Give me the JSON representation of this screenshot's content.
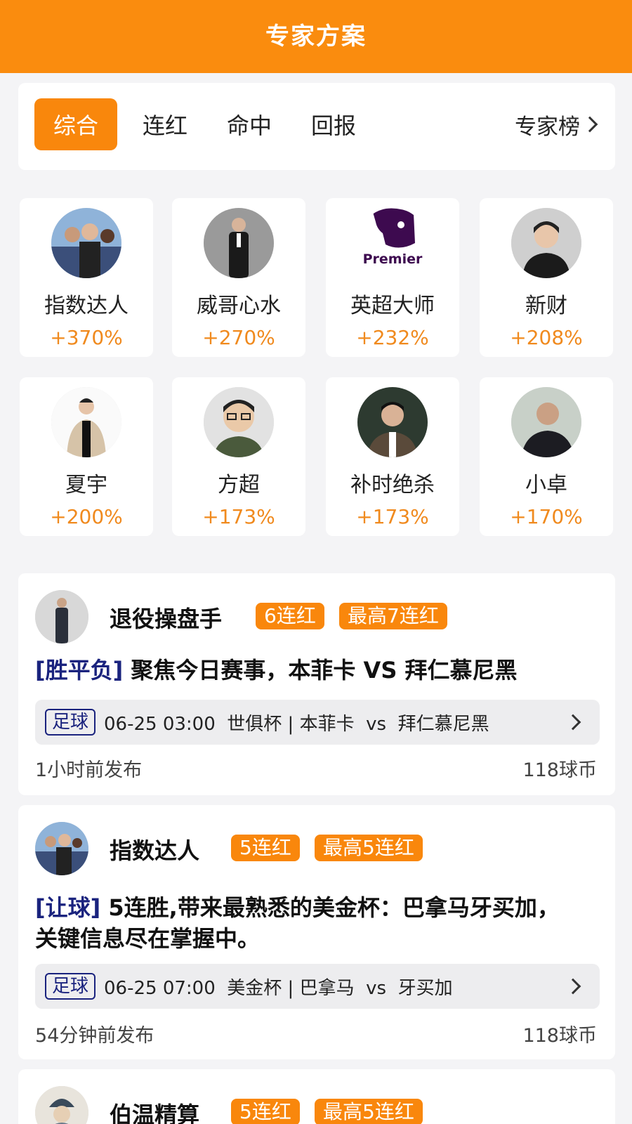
{
  "header": {
    "title": "专家方案"
  },
  "tabs": [
    "综合",
    "连红",
    "命中",
    "回报"
  ],
  "ranking_link": "专家榜",
  "experts": [
    {
      "name": "指数达人",
      "rate": "+370%"
    },
    {
      "name": "威哥心水",
      "rate": "+270%"
    },
    {
      "name": "英超大师",
      "rate": "+232%",
      "avatar_text": "Premier"
    },
    {
      "name": "新财",
      "rate": "+208%"
    },
    {
      "name": "夏宇",
      "rate": "+200%"
    },
    {
      "name": "方超",
      "rate": "+173%"
    },
    {
      "name": "补时绝杀",
      "rate": "+173%"
    },
    {
      "name": "小卓",
      "rate": "+170%"
    }
  ],
  "plans": [
    {
      "expert": "退役操盘手",
      "streak": "6连红",
      "max_streak": "最高7连红",
      "tag": "[胜平负]",
      "title": "聚焦今日赛事，本菲卡 VS 拜仁慕尼黑",
      "sport": "足球",
      "match": "06-25 03:00  世俱杯 | 本菲卡  vs  拜仁慕尼黑",
      "time": "1小时前发布",
      "price": "118球币"
    },
    {
      "expert": "指数达人",
      "streak": "5连红",
      "max_streak": "最高5连红",
      "tag": "[让球]",
      "title_line1": "5连胜,带来最熟悉的美金杯：巴拿马牙买加，",
      "title_line2": "关键信息尽在掌握中。",
      "sport": "足球",
      "match": "06-25 07:00  美金杯 | 巴拿马  vs  牙买加",
      "time": "54分钟前发布",
      "price": "118球币"
    },
    {
      "expert": "伯温精算",
      "streak": "5连红",
      "max_streak": "最高5连红"
    }
  ],
  "colors": {
    "accent": "#fa8c0e",
    "rate": "#f08a1e",
    "tag": "#1a237e"
  }
}
